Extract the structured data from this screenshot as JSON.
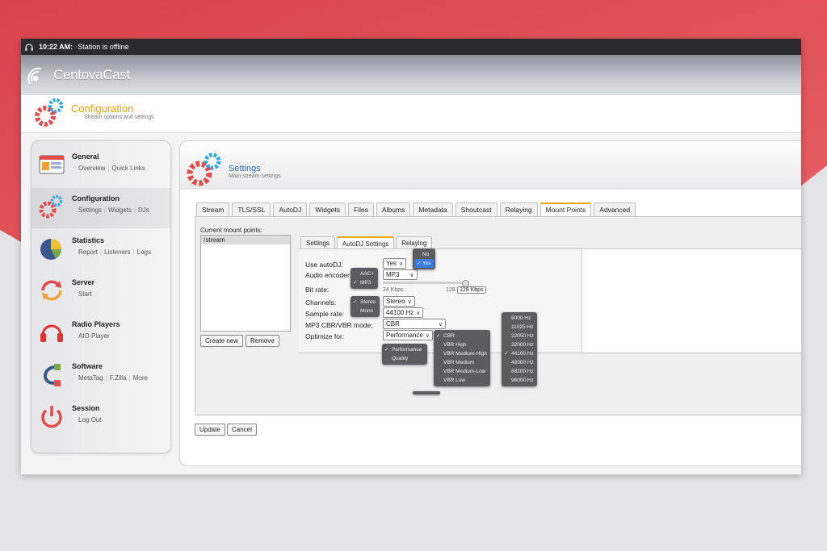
{
  "statusbar": {
    "time": "10:22 AM:",
    "status": "Station is offline"
  },
  "brand": {
    "name": "CentovaCast"
  },
  "page": {
    "title": "Configuration",
    "subtitle": "Stream options and settings"
  },
  "sidebar": {
    "items": [
      {
        "title": "General",
        "links": [
          "Overview",
          "Quick Links"
        ]
      },
      {
        "title": "Configuration",
        "links": [
          "Settings",
          "Widgets",
          "DJs"
        ]
      },
      {
        "title": "Statistics",
        "links": [
          "Report",
          "Listeners",
          "Logs"
        ]
      },
      {
        "title": "Server",
        "links": [
          "Start"
        ]
      },
      {
        "title": "Radio Players",
        "links": [
          "AIO Player"
        ]
      },
      {
        "title": "Software",
        "links": [
          "MetaTag",
          "F.Zilla",
          "More"
        ]
      },
      {
        "title": "Session",
        "links": [
          "Log Out"
        ]
      }
    ]
  },
  "panel": {
    "title": "Settings",
    "subtitle": "Main stream settings",
    "tabs": [
      "Stream",
      "TLS/SSL",
      "AutoDJ",
      "Widgets",
      "Files",
      "Albums",
      "Metadata",
      "Shoutcast",
      "Relaying",
      "Mount Points",
      "Advanced"
    ],
    "active_tab": "Mount Points"
  },
  "mounts": {
    "label": "Current mount points:",
    "items": [
      "/stream"
    ],
    "create_label": "Create new",
    "remove_label": "Remove"
  },
  "inner_tabs": {
    "items": [
      "Settings",
      "AutoDJ Settings",
      "Relaying"
    ],
    "active": "AutoDJ Settings"
  },
  "form": {
    "use_autodj": {
      "label": "Use autoDJ:",
      "value": "Yes",
      "options": [
        "No",
        "Yes"
      ]
    },
    "encoder": {
      "label": "Audio encoder:",
      "value": "MP3",
      "options": [
        "AAC+",
        "MP3"
      ]
    },
    "bitrate": {
      "label": "Bit rate:",
      "min_label": "24 Kbps",
      "mid_label": "128",
      "value": "128 Kbps",
      "level": 0.96
    },
    "channels": {
      "label": "Channels:",
      "value": "Stereo",
      "options": [
        "Stereo",
        "Mono"
      ]
    },
    "sample_rate": {
      "label": "Sample rate:",
      "value": "44100 Hz",
      "options": [
        "8000 Hz",
        "11025 Hz",
        "22050 Hz",
        "32000 Hz",
        "44100 Hz",
        "48000 Hz",
        "88200 Hz",
        "96000 Hz"
      ]
    },
    "cbr_vbr": {
      "label": "MP3 CBR/VBR mode:",
      "value": "CBR",
      "options": [
        "CBR",
        "VBR High",
        "VBR Medium-High",
        "VBR Medium",
        "VBR Medium-Low",
        "VBR Low"
      ]
    },
    "optimize": {
      "label": "Optimize for:",
      "value": "Performance",
      "options": [
        "Performance",
        "Quality"
      ]
    }
  },
  "actions": {
    "update_label": "Update",
    "cancel_label": "Cancel"
  },
  "checkmark": "✓",
  "caret": "∨",
  "colors": {
    "accent": "#e8a400",
    "link_blue": "#2a6fb0",
    "menu_highlight": "#3b7be0",
    "brand_red": "#d94a4f"
  }
}
